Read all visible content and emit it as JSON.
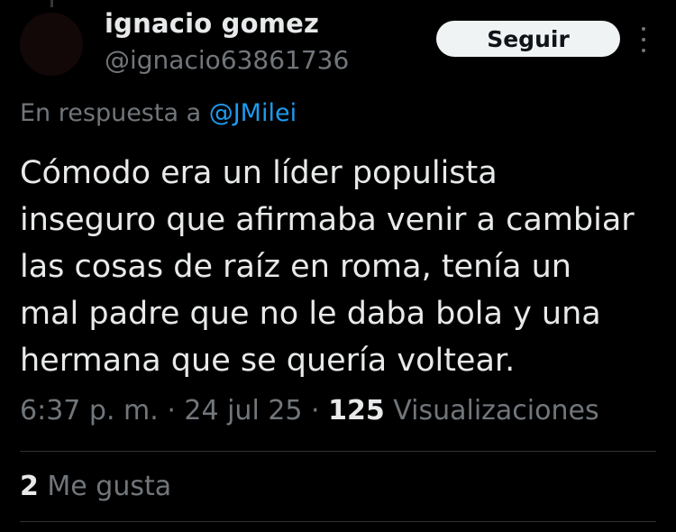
{
  "author": {
    "display_name": "ignacio gomez",
    "handle": "@ignacio63861736"
  },
  "follow_button_label": "Seguir",
  "reply": {
    "prefix": "En respuesta a ",
    "mention": "@JMilei"
  },
  "tweet": {
    "text_lines": [
      "Cómodo era un líder populista",
      "inseguro que afirmaba venir a cambiar",
      "las cosas de raíz en roma, tenía un",
      "mal padre que no le daba bola y una",
      "hermana que se quería voltear."
    ]
  },
  "meta": {
    "time": "6:37 p. m.",
    "separator": " · ",
    "date": "24 jul 25",
    "views_count": "125",
    "views_label": " Visualizaciones"
  },
  "likes": {
    "count": "2",
    "label": " Me gusta"
  },
  "colors": {
    "background": "#000000",
    "primary_text": "#e7e9ea",
    "secondary_text": "#71767b",
    "mention": "#1d9bf0",
    "follow_button_bg": "#eff3f4"
  },
  "icons": {
    "more": "more-vertical-icon"
  }
}
